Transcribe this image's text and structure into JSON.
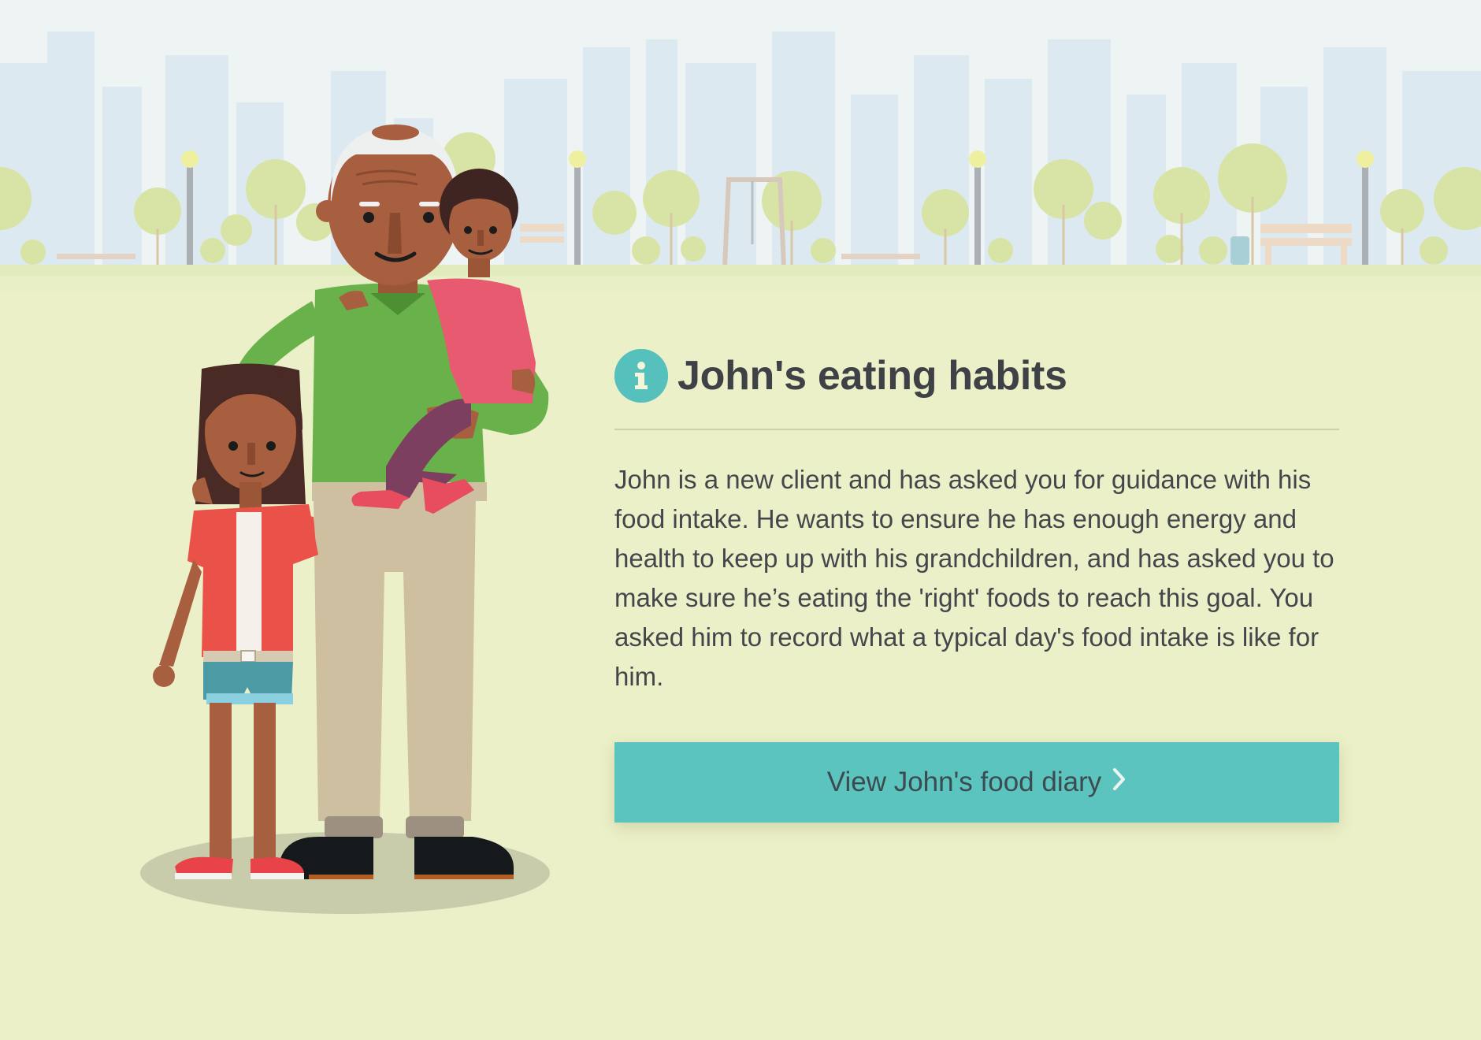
{
  "scene": {
    "background_colors": {
      "sky": "#eaf2f4",
      "ground": "#ecf0c8",
      "grass_band": "#e4f0c0",
      "tree": "#d6e2a4",
      "skyline": "#d9e8f2"
    }
  },
  "illustration": {
    "subject": "grandfather holding a granddaughter with another granddaughter beside him"
  },
  "info_panel": {
    "icon": "info-icon",
    "icon_color": "#56c0bd",
    "heading": "John's eating habits",
    "body": "John is a new client and has asked you for guidance with his food intake. He wants to ensure he has enough energy and health to keep up with his grandchildren, and has asked you to make sure he’s eating the 'right' foods to reach this goal. You asked him to record what a typical day's food intake is like for him.",
    "cta_label": "View John's food diary",
    "cta_icon": "chevron-right-icon",
    "cta_color": "#5cc4bf"
  }
}
